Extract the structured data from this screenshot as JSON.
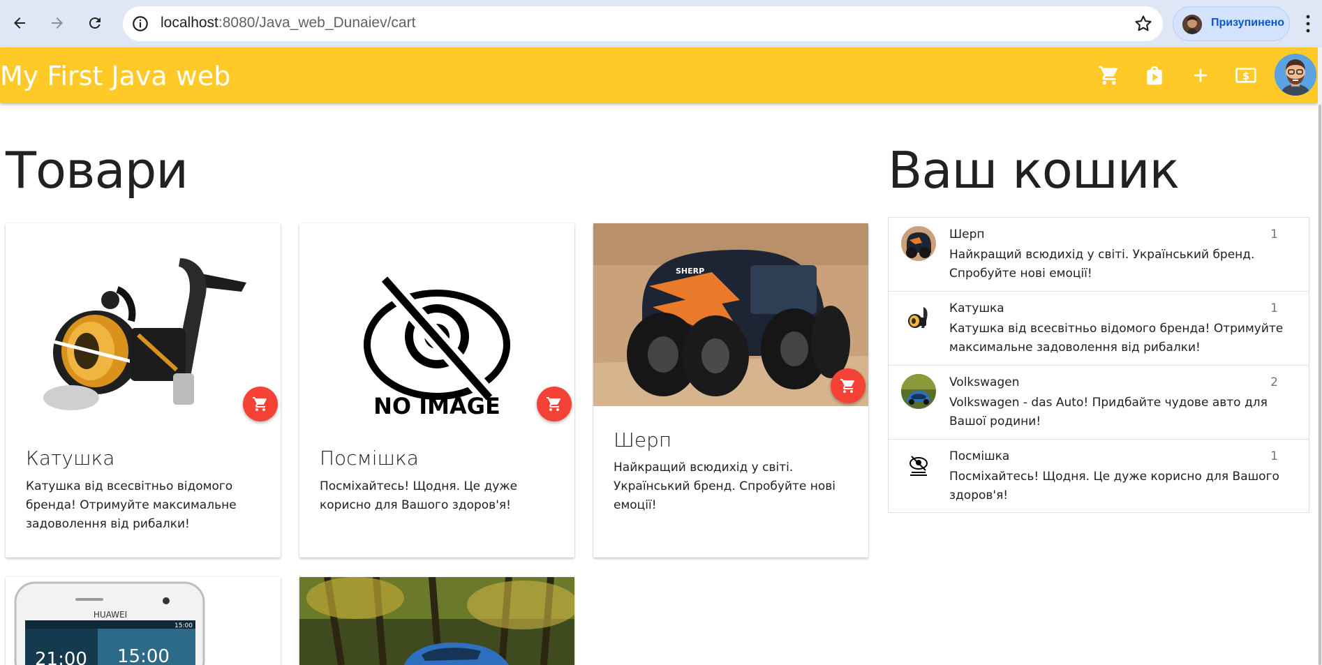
{
  "browser": {
    "url_host": "localhost",
    "url_path": ":8080/Java_web_Dunaiev/cart",
    "profile_label": "Призупинено"
  },
  "app": {
    "brand": "My First Java web",
    "icons": [
      "cart-icon",
      "shopping-bag-icon",
      "add-icon",
      "dollar-icon"
    ],
    "accent_color": "#ffca28",
    "fab_color": "#f44336"
  },
  "products": {
    "heading": "Товари",
    "items": [
      {
        "title": "Катушка",
        "desc": "Катушка від всесвітньо відомого бренда! Отримуйте максимальне задоволення від рибалки!",
        "image": "fishing-reel"
      },
      {
        "title": "Посмішка",
        "desc": "Посміхайтесь! Щодня. Це дуже корисно для Вашого здоров'я!",
        "image": "no-image",
        "image_text": "NO IMAGE"
      },
      {
        "title": "Шерп",
        "desc": "Найкращий всюдихід у світі. Український бренд. Спробуйте нові емоції!",
        "image": "sherp-vehicle",
        "image_text": "SHERP"
      },
      {
        "image": "smartphone",
        "image_text": "HUAWEI",
        "clock_left": "21:00",
        "clock_right": "15:00",
        "status_time": "15:00"
      },
      {
        "image": "car"
      }
    ]
  },
  "cart": {
    "heading": "Ваш кошик",
    "items": [
      {
        "title": "Шерп",
        "desc": "Найкращий всюдихід у світі. Український бренд. Спробуйте нові емоції!",
        "qty": "1"
      },
      {
        "title": "Катушка",
        "desc": "Катушка від всесвітньо відомого бренда! Отримуйте максимальне задоволення від рибалки!",
        "qty": "1"
      },
      {
        "title": "Volkswagen",
        "desc": "Volkswagen - das Auto! Придбайте чудове авто для Вашої родини!",
        "qty": "2"
      },
      {
        "title": "Посмішка",
        "desc": "Посміхайтесь! Щодня. Це дуже корисно для Вашого здоров'я!",
        "qty": "1"
      }
    ]
  }
}
